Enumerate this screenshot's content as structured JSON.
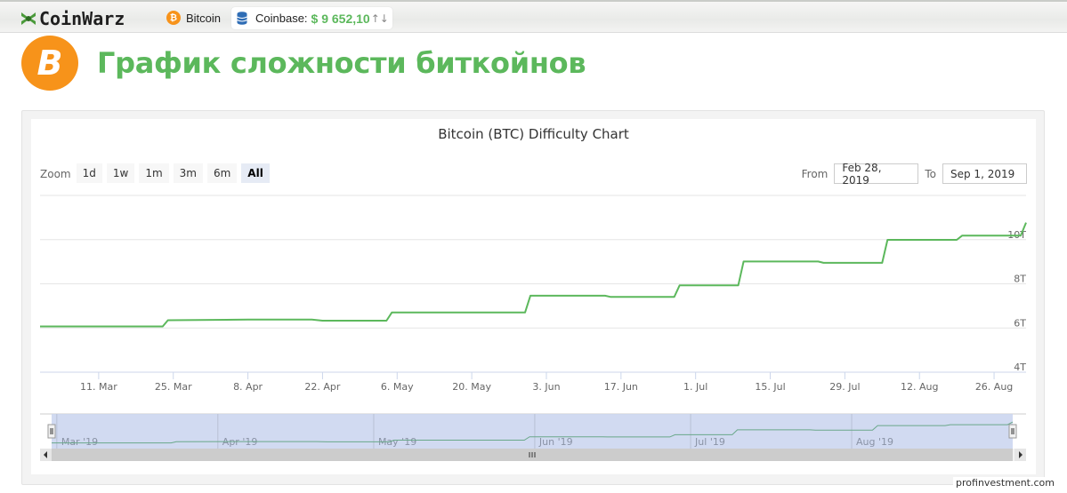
{
  "topbar": {
    "logo_text": "CoinWarz",
    "coin_label": "Bitcoin",
    "coin_symbol": "₿",
    "exchange_label": "Coinbase:",
    "price": "$ 9 652,10",
    "price_arrows": "↑↓",
    "icons": {
      "logo": "coinwarz-logo-icon",
      "coin": "bitcoin-icon",
      "exchange": "database-icon"
    }
  },
  "heading": {
    "title": "График сложности биткойнов",
    "icon_symbol": "B"
  },
  "controls": {
    "zoom_label": "Zoom",
    "zoom_buttons": [
      "1d",
      "1w",
      "1m",
      "3m",
      "6m",
      "All"
    ],
    "active_zoom": "All",
    "from_label": "From",
    "from_value": "Feb 28, 2019",
    "to_label": "To",
    "to_value": "Sep 1, 2019"
  },
  "watermark": "profinvestment.com",
  "colors": {
    "line": "#5cb85c",
    "accent_green": "#5cb85c",
    "bitcoin_orange": "#f7931a",
    "navigator_mask": "#ccd6f0"
  },
  "chart_data": {
    "type": "line",
    "title": "Bitcoin (BTC) Difficulty Chart",
    "xlabel": "",
    "ylabel": "",
    "x_range": [
      "2019-02-28",
      "2019-09-01"
    ],
    "ylim": [
      4,
      12
    ],
    "y_unit": "T",
    "y_ticks": [
      4,
      6,
      8,
      10,
      12
    ],
    "y_tick_labels": [
      "4T",
      "6T",
      "8T",
      "10T",
      ""
    ],
    "x_ticks": [
      "2019-03-11",
      "2019-03-25",
      "2019-04-08",
      "2019-04-22",
      "2019-05-06",
      "2019-05-20",
      "2019-06-03",
      "2019-06-17",
      "2019-07-01",
      "2019-07-15",
      "2019-07-29",
      "2019-08-12",
      "2019-08-26"
    ],
    "x_tick_labels": [
      "11. Mar",
      "25. Mar",
      "8. Apr",
      "22. Apr",
      "6. May",
      "20. May",
      "3. Jun",
      "17. Jun",
      "1. Jul",
      "15. Jul",
      "29. Jul",
      "12. Aug",
      "26. Aug"
    ],
    "grid": true,
    "legend": "none",
    "series": [
      {
        "name": "Difficulty",
        "points": [
          [
            "2019-02-28",
            6.07
          ],
          [
            "2019-03-23",
            6.07
          ],
          [
            "2019-03-24",
            6.35
          ],
          [
            "2019-04-08",
            6.38
          ],
          [
            "2019-04-20",
            6.38
          ],
          [
            "2019-04-22",
            6.33
          ],
          [
            "2019-05-04",
            6.33
          ],
          [
            "2019-05-05",
            6.7
          ],
          [
            "2019-05-30",
            6.7
          ],
          [
            "2019-05-31",
            7.46
          ],
          [
            "2019-06-14",
            7.46
          ],
          [
            "2019-06-15",
            7.41
          ],
          [
            "2019-06-27",
            7.41
          ],
          [
            "2019-06-28",
            7.93
          ],
          [
            "2019-07-09",
            7.93
          ],
          [
            "2019-07-10",
            9.01
          ],
          [
            "2019-07-24",
            9.01
          ],
          [
            "2019-07-25",
            8.95
          ],
          [
            "2019-08-05",
            8.95
          ],
          [
            "2019-08-06",
            9.99
          ],
          [
            "2019-08-19",
            9.99
          ],
          [
            "2019-08-20",
            10.18
          ],
          [
            "2019-08-31",
            10.18
          ],
          [
            "2019-09-01",
            10.77
          ]
        ]
      }
    ],
    "navigator": {
      "x_labels": [
        "Mar '19",
        "Apr '19",
        "May '19",
        "Jun '19",
        "Jul '19",
        "Aug '19"
      ],
      "x_label_dates": [
        "2019-03-01",
        "2019-04-01",
        "2019-05-01",
        "2019-06-01",
        "2019-07-01",
        "2019-08-01"
      ],
      "selected_range": [
        "2019-02-28",
        "2019-09-01"
      ]
    }
  }
}
